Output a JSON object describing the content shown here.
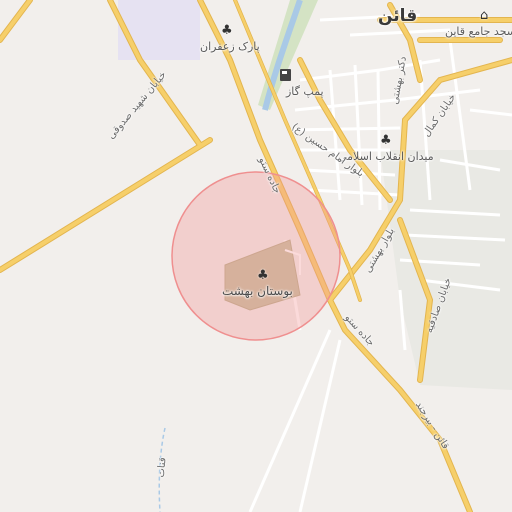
{
  "map": {
    "city_label": "قائن",
    "labels": {
      "park_zaferan": "پارک زعفران",
      "gas_station": "پمپ گاز",
      "revolution_square": "میدان انقلاب اسلامی",
      "mosque": "مسجد جامع قاین",
      "behesht_park": "بوستان بهشت",
      "street_shahid_sadughi": "خیابان شهید صدوقی",
      "road_setoo_north": "جاده ستو",
      "road_setoo_south": "جاده ستو",
      "blvd_imam_hossein": "بلوار امام حسین (ع)",
      "blvd_behesti": "بلوار بهشتی",
      "street_kamal": "خیابان کمال",
      "street_sadeghieh": "خیابان صادقیه",
      "street_dr_behesti": "دکتر بهشتی",
      "road_qaen_birjand": "قائن - بیرجند",
      "qanat": "قنات"
    },
    "icons": {
      "park_zaferan": "tree-icon",
      "behesht_park": "tree-icon",
      "revolution_square": "tree-icon",
      "mosque": "mosque-icon",
      "gas_station": "fuel-icon"
    },
    "colors": {
      "background": "#f2efec",
      "major_road": "#f6cf6a",
      "highlight_circle": "#f4a3a3",
      "park": "#c7c0a0",
      "water": "#a9c9e6"
    }
  }
}
